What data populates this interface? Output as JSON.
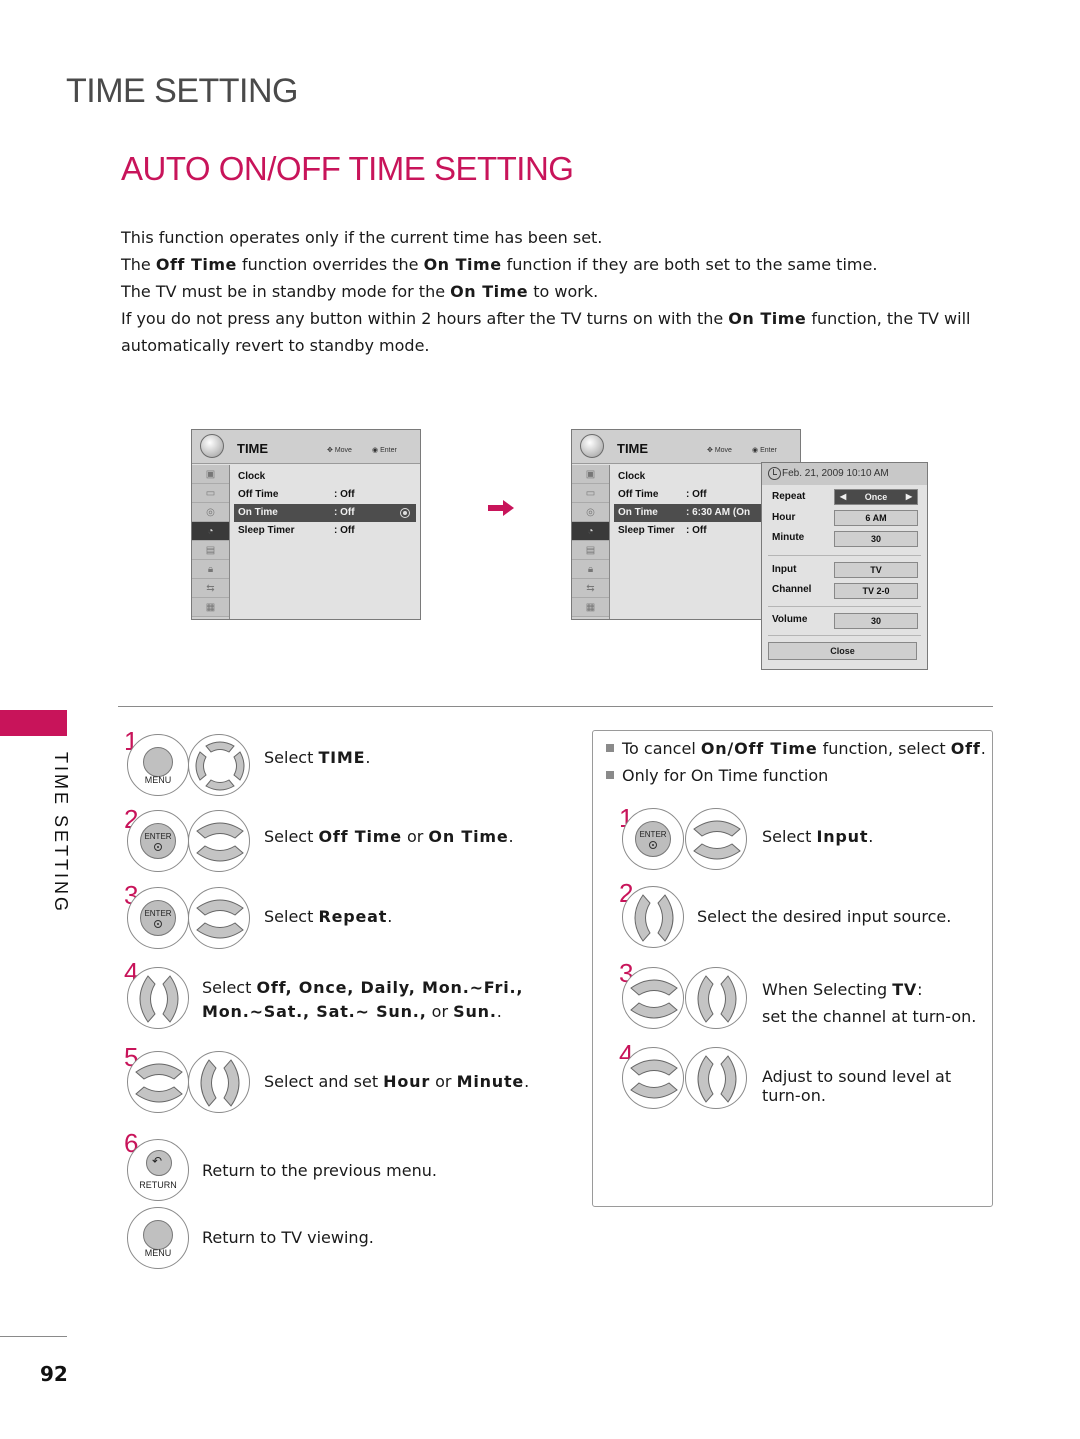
{
  "section_title": "TIME SETTING",
  "page_title": "AUTO ON/OFF TIME SETTING",
  "intro": [
    {
      "pre": "This function operates only if the current time has been set.",
      "b1": "",
      "mid": "",
      "b2": "",
      "post": ""
    },
    {
      "pre": "The ",
      "b1": "Off Time",
      "mid": " function overrides the ",
      "b2": "On Time",
      "post": " function if they are both set to the same time."
    },
    {
      "pre": "The TV must be in standby mode for the ",
      "b1": "On Time",
      "mid": " to work.",
      "b2": "",
      "post": ""
    },
    {
      "pre": "If you do not press any button within 2 hours after the TV turns on with the ",
      "b1": "On Time",
      "mid": " function, the TV will automatically revert to standby mode.",
      "b2": "",
      "post": ""
    }
  ],
  "menu_before": {
    "title": "TIME",
    "hint_move": "Move",
    "hint_enter": "Enter",
    "side_icons": [
      "setup-icon",
      "picture-icon",
      "audio-icon",
      "time-icon",
      "option-icon",
      "lock-icon",
      "input-icon",
      "usb-icon"
    ],
    "selected_side_index": 3,
    "rows": [
      {
        "label": "Clock",
        "value": ""
      },
      {
        "label": "Off Time",
        "value": ": Off"
      },
      {
        "label": "On Time",
        "value": ": Off",
        "selected": true
      },
      {
        "label": "Sleep Timer",
        "value": ": Off"
      }
    ]
  },
  "menu_after": {
    "title": "TIME",
    "hint_move": "Move",
    "hint_enter": "Enter",
    "rows": [
      {
        "label": "Clock",
        "value": ""
      },
      {
        "label": "Off Time",
        "value": ": Off"
      },
      {
        "label": "On Time",
        "value": ": 6:30 AM (On",
        "selected": true
      },
      {
        "label": "Sleep Timer",
        "value": ": Off"
      }
    ],
    "popup": {
      "datetime": "Feb. 21, 2009    10:10 AM",
      "fields": [
        {
          "label": "Repeat",
          "value": "Once"
        },
        {
          "label": "Hour",
          "value": "6 AM"
        },
        {
          "label": "Minute",
          "value": "30"
        },
        {
          "label": "Input",
          "value": "TV"
        },
        {
          "label": "Channel",
          "value": "TV 2-0"
        },
        {
          "label": "Volume",
          "value": "30"
        }
      ],
      "close_label": "Close"
    }
  },
  "side_label": "TIME SETTING",
  "buttons": {
    "menu": "MENU",
    "enter": "ENTER",
    "return": "RETURN"
  },
  "steps_left": [
    {
      "num": "1",
      "pre": "Select ",
      "b": "TIME",
      "post": "."
    },
    {
      "num": "2",
      "pre": "Select ",
      "b": "Off Time",
      "mid": " or ",
      "b2": "On Time",
      "post": "."
    },
    {
      "num": "3",
      "pre": "Select ",
      "b": "Repeat",
      "post": "."
    },
    {
      "num": "4",
      "line1_pre": "Select ",
      "line1_b": "Off, Once, Daily, Mon.~Fri.,",
      "line2_b": "Mon.~Sat., Sat.~ Sun.,",
      "line2_mid": " or ",
      "line2_b2": "Sun.",
      "line2_post": "."
    },
    {
      "num": "5",
      "pre": "Select and set ",
      "b": "Hour",
      "mid": " or ",
      "b2": "Minute",
      "post": "."
    },
    {
      "num": "6",
      "text": "Return to the previous menu."
    },
    {
      "num": "",
      "text": "Return to TV viewing."
    }
  ],
  "notes": [
    {
      "pre": "To cancel ",
      "b": "On/Off Time",
      "mid": " function, select ",
      "b2": "Off",
      "post": "."
    },
    {
      "pre": "Only for On Time function",
      "b": "",
      "mid": "",
      "b2": "",
      "post": ""
    }
  ],
  "steps_right": [
    {
      "num": "1",
      "pre": "Select ",
      "b": "Input",
      "post": "."
    },
    {
      "num": "2",
      "text": "Select the desired input source."
    },
    {
      "num": "3",
      "line1_pre": "When Selecting ",
      "line1_b": "TV",
      "line1_post": ":",
      "line2": "set the channel at turn-on."
    },
    {
      "num": "4",
      "line1": "Adjust to sound level at",
      "line2": "turn-on."
    }
  ],
  "page_number": "92",
  "colors": {
    "accent": "#c8145a",
    "heading_gray": "#4a4a4a",
    "menu_bg": "#e2e2e2",
    "menu_selected": "#4d4d4d"
  }
}
